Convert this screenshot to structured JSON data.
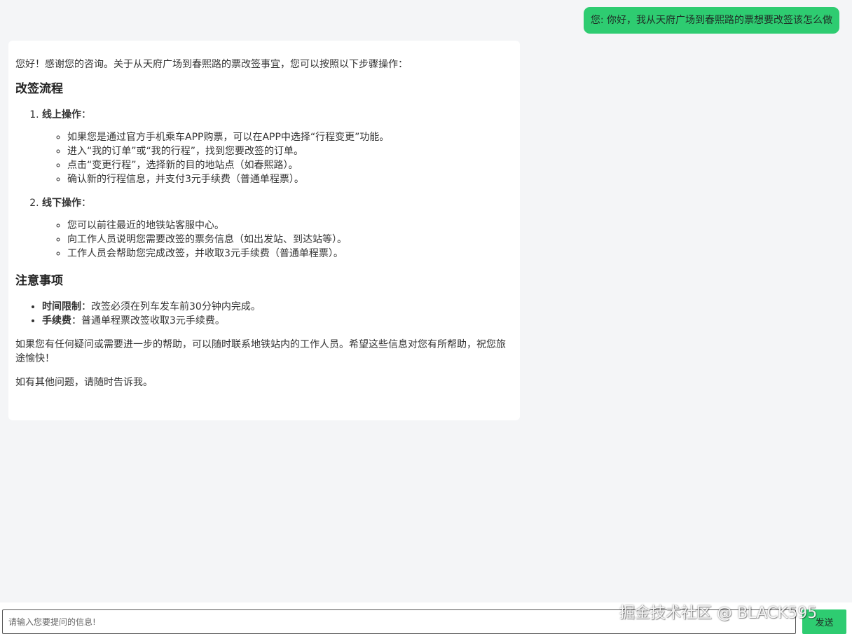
{
  "user_message": {
    "text": "您: 你好，我从天府广场到春熙路的票想要改签该怎么做"
  },
  "bot_message": {
    "intro": "您好！感谢您的咨询。关于从天府广场到春熙路的票改签事宜，您可以按照以下步骤操作：",
    "section1_title": "改签流程",
    "steps": [
      {
        "title": "线上操作",
        "colon": "：",
        "items": [
          "如果您是通过官方手机乘车APP购票，可以在APP中选择“行程变更”功能。",
          "进入“我的订单”或“我的行程”，找到您要改签的订单。",
          "点击“变更行程”，选择新的目的地站点（如春熙路）。",
          "确认新的行程信息，并支付3元手续费（普通单程票）。"
        ]
      },
      {
        "title": "线下操作",
        "colon": "：",
        "items": [
          "您可以前往最近的地铁站客服中心。",
          "向工作人员说明您需要改签的票务信息（如出发站、到达站等）。",
          "工作人员会帮助您完成改签，并收取3元手续费（普通单程票）。"
        ]
      }
    ],
    "section2_title": "注意事项",
    "notes": [
      {
        "label": "时间限制",
        "text": "：改签必须在列车发车前30分钟内完成。"
      },
      {
        "label": "手续费",
        "text": "：普通单程票改签收取3元手续费。"
      }
    ],
    "closing": "如果您有任何疑问或需要进一步的帮助，可以随时联系地铁站内的工作人员。希望这些信息对您有所帮助，祝您旅途愉快！",
    "final": "如有其他问题，请随时告诉我。"
  },
  "input_bar": {
    "placeholder": "请输入您要提问的信息!",
    "value": "",
    "send_label": "发送"
  },
  "watermark": "掘金技术社区 @ BLACK595",
  "colors": {
    "accent": "#2ecc71",
    "page_background": "#f4f5f7",
    "bubble_background": "#ffffff"
  }
}
